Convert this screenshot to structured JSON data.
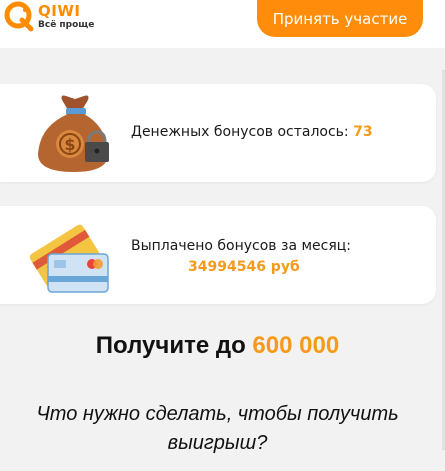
{
  "header": {
    "logo_text": "QIWI",
    "slogan": "Всё проще",
    "cta_label": "Принять участие"
  },
  "cards": [
    {
      "label": "Денежных бонусов осталось:",
      "value": "73",
      "icon": "money-bag-icon"
    },
    {
      "label": "Выплачено бонусов за месяц:",
      "value": "34994546 руб",
      "icon": "bank-cards-icon"
    }
  ],
  "headline": {
    "prefix": "Получите до",
    "amount": "600 000"
  },
  "question": {
    "line1": "Что нужно сделать, чтобы получить",
    "line2": "выигрыш?"
  },
  "colors": {
    "brand_orange": "#ff8c0a",
    "accent_text": "#f59a1b",
    "background": "#f2f2f2"
  }
}
